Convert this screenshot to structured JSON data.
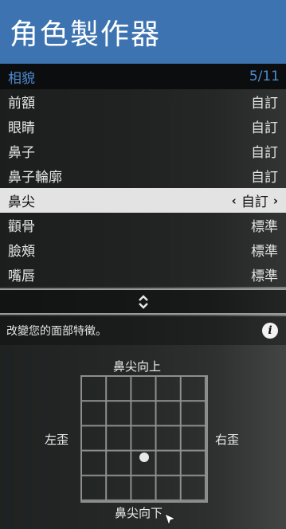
{
  "header": {
    "title": "角色製作器"
  },
  "subheader": {
    "label": "相貌",
    "page": "5/11"
  },
  "menu": {
    "items": [
      {
        "label": "前額",
        "value": "自訂",
        "selected": false
      },
      {
        "label": "眼睛",
        "value": "自訂",
        "selected": false
      },
      {
        "label": "鼻子",
        "value": "自訂",
        "selected": false
      },
      {
        "label": "鼻子輪廓",
        "value": "自訂",
        "selected": false
      },
      {
        "label": "鼻尖",
        "value": "自訂",
        "selected": true
      },
      {
        "label": "顴骨",
        "value": "標準",
        "selected": false
      },
      {
        "label": "臉頰",
        "value": "標準",
        "selected": false
      },
      {
        "label": "嘴唇",
        "value": "標準",
        "selected": false
      }
    ],
    "arrow_left": "‹",
    "arrow_right": "›"
  },
  "description": {
    "text": "改變您的面部特徵。",
    "icon": "info-icon"
  },
  "pad": {
    "up_label": "鼻尖向上",
    "down_label": "鼻尖向下",
    "left_label": "左歪",
    "right_label": "右歪",
    "position": {
      "x": 0.0,
      "y": -0.3
    }
  },
  "colors": {
    "header_bg": "#3d73b0",
    "subheader_text": "#4f8bd0",
    "selected_row_bg": "#e3e3e3"
  }
}
